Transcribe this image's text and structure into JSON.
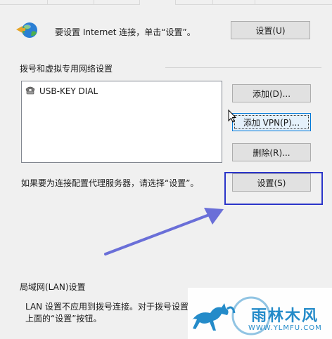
{
  "internet": {
    "text": "要设置 Internet 连接，单击“设置”。",
    "button": "设置(U)"
  },
  "dialup": {
    "title": "拨号和虚拟专用网络设置",
    "items": [
      "USB-KEY DIAL"
    ],
    "add_button": "添加(D)...",
    "add_vpn_button": "添加 VPN(P)...",
    "remove_button": "删除(R)...",
    "proxy_text": "如果要为连接配置代理服务器，请选择“设置”。",
    "settings_button": "设置(S)"
  },
  "lan": {
    "title": "局域网(LAN)设置",
    "line1": "LAN 设置不应用到拨号连接。对于拨号设置",
    "line2": "上面的“设置”按钮。"
  },
  "watermark": {
    "brand": "雨林木风",
    "url": "WWW.YLMFU.COM"
  },
  "colors": {
    "highlight": "#2b35c9",
    "arrow": "#6a6fd8"
  }
}
